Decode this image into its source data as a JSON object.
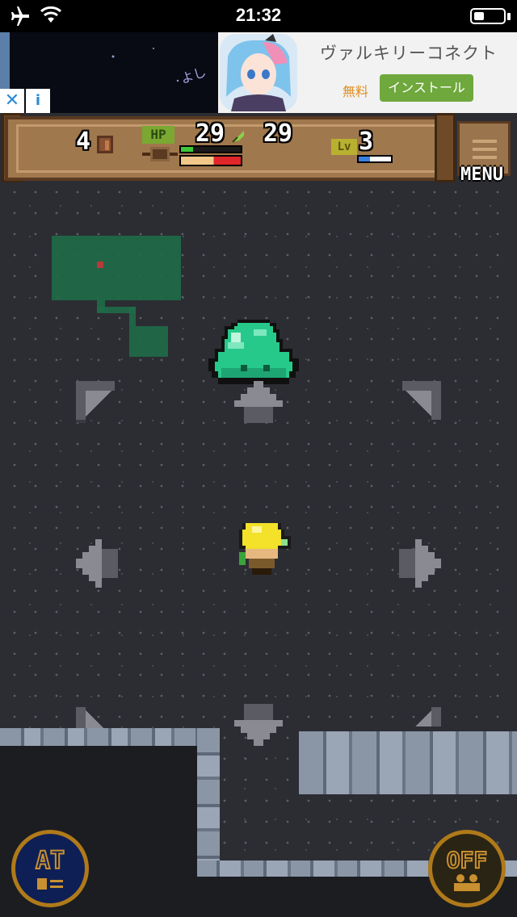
{
  "status_bar": {
    "time": "21:32",
    "battery_level": 0.35
  },
  "ad": {
    "title": "ヴァルキリーコネクト",
    "free_label": "無料",
    "install_label": "インストール",
    "close_glyph": "✕",
    "info_glyph": "i"
  },
  "hud": {
    "floor": "4",
    "hp_tag": "HP",
    "hp_current": "29",
    "hp_max": "29",
    "hp_fraction": 1.0,
    "stamina_fraction": 0.2,
    "level_tag": "Lv",
    "level": "3",
    "exp_fraction": 0.35,
    "menu_label": "MENU"
  },
  "controls": {
    "auto_label": "AT",
    "toggle_label": "OFF"
  },
  "colors": {
    "floor": "#2c2d33",
    "slime": "#27c98a",
    "player_hair": "#f3e12a",
    "minimap": "#1f6b48",
    "hp_bar": "#e0262a",
    "exp_bar": "#3b7fe0",
    "button_ring": "#b07a1a"
  }
}
